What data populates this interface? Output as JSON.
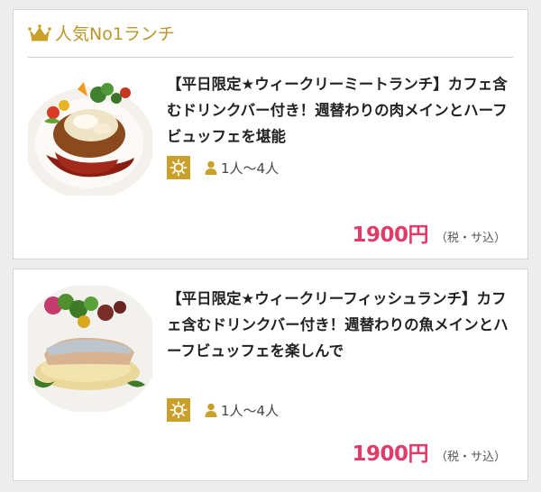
{
  "ranking": {
    "label": "人気No1ランチ",
    "icon": "crown-icon",
    "color": "#b8962a"
  },
  "plans": [
    {
      "title": "【平日限定★ウィークリーミートランチ】カフェ含むドリンクバー付き！週替わりの肉メインとハーフビュッフェを堪能",
      "image": "meat-dish-photo",
      "time_icon": "sun-icon",
      "persons": "1人～4人",
      "price": "1900円",
      "tax_note": "（税・サ込）"
    },
    {
      "title": "【平日限定★ウィークリーフィッシュランチ】カフェ含むドリンクバー付き！週替わりの魚メインとハーフビュッフェを楽しんで",
      "image": "fish-dish-photo",
      "time_icon": "sun-icon",
      "persons": "1人～4人",
      "price": "1900円",
      "tax_note": "（税・サ込）"
    }
  ],
  "colors": {
    "price": "#e03c6a",
    "badge": "#c9a12a",
    "background": "#ededed"
  }
}
